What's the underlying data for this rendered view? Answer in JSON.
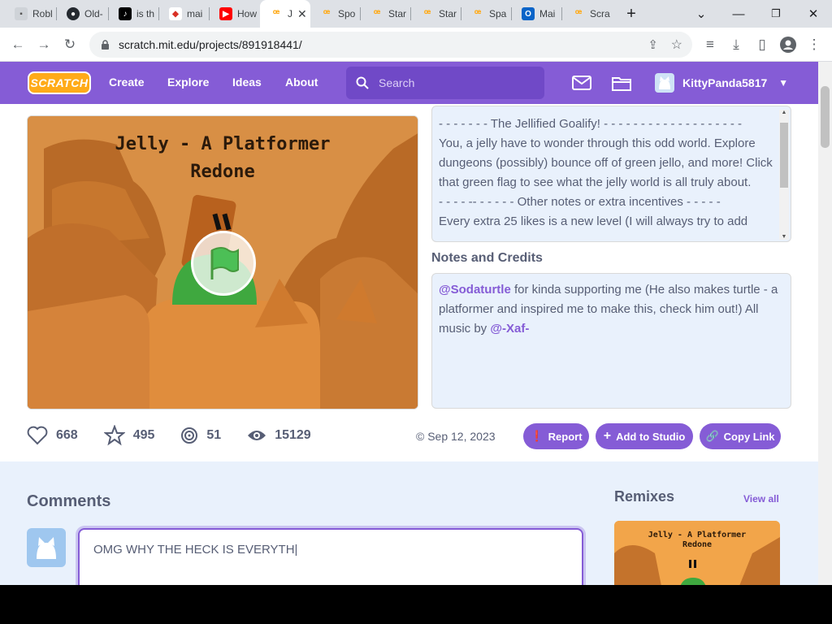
{
  "browser": {
    "tabs": [
      {
        "label": "Robl",
        "icon": "roblox-favicon"
      },
      {
        "label": "Old-",
        "icon": "github-favicon"
      },
      {
        "label": "is th",
        "icon": "tiktok-favicon"
      },
      {
        "label": "mai",
        "icon": "generic-favicon"
      },
      {
        "label": "How",
        "icon": "youtube-favicon"
      },
      {
        "label": "J",
        "icon": "scratch-favicon",
        "active": true
      },
      {
        "label": "Spo",
        "icon": "scratch-favicon"
      },
      {
        "label": "Star",
        "icon": "scratch-favicon"
      },
      {
        "label": "Star",
        "icon": "scratch-favicon"
      },
      {
        "label": "Spa",
        "icon": "scratch-favicon"
      },
      {
        "label": "Mai",
        "icon": "outlook-favicon"
      },
      {
        "label": "Scra",
        "icon": "scratch-favicon"
      }
    ],
    "url": "scratch.mit.edu/projects/891918441/"
  },
  "nav": {
    "logo": "SCRATCH",
    "links": [
      "Create",
      "Explore",
      "Ideas",
      "About"
    ],
    "search_placeholder": "Search",
    "username": "KittyPanda5817"
  },
  "project": {
    "stage_title_line1": "Jelly - A Platformer",
    "stage_title_line2": "Redone",
    "instructions": [
      "- - - - - - - The Jellified Goalify! - - - - - - - - - - - - - - - - - - -",
      "You, a jelly have to wonder through this odd world. Explore dungeons (possibly) bounce off of green jello, and more! Click that green flag to see what the jelly world is all truly about.",
      "- - - - -- - - - - - Other notes or extra incentives - - - - -",
      "Every extra 25 likes is a new level (I will always try to add"
    ],
    "notes_heading": "Notes and Credits",
    "notes": {
      "mention1": "@Sodaturtle",
      "text1": " for kinda supporting me (He also makes turtle - a platformer and inspired me to make this, check him out!) All music by ",
      "mention2": "@-Xaf-"
    },
    "stats": {
      "loves": "668",
      "favorites": "495",
      "remixes": "51",
      "views": "15129"
    },
    "date": "Sep 12, 2023",
    "buttons": {
      "report": "Report",
      "add_to_studio": "Add to Studio",
      "copy_link": "Copy Link"
    }
  },
  "comments": {
    "heading": "Comments",
    "draft": "OMG WHY THE HECK IS EVERYTH|"
  },
  "remixes": {
    "heading": "Remixes",
    "view_all": "View all",
    "thumb_title_line1": "Jelly - A Platformer",
    "thumb_title_line2": "Redone"
  },
  "colors": {
    "scratch_purple": "#855cd6",
    "light_blue_bg": "#e9f1fc",
    "text_gray": "#575e75"
  }
}
